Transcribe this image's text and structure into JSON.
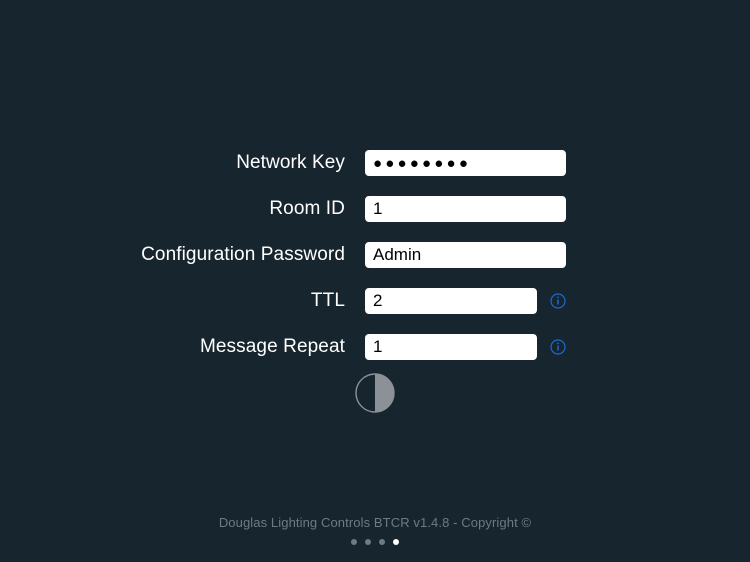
{
  "app": {
    "background_color": "#17252e",
    "accent_color": "#1c69d4",
    "field_background": "#ffffff",
    "label_color": "#ffffff",
    "footer_color": "#6d7b82"
  },
  "form": {
    "fields": [
      {
        "label": "Network Key",
        "value": "●●●●●●●●",
        "placeholder": "",
        "masked": true,
        "has_info": false
      },
      {
        "label": "Room ID",
        "value": "1",
        "placeholder": "",
        "masked": false,
        "has_info": false
      },
      {
        "label": "Configuration Password",
        "value": "Admin",
        "placeholder": "",
        "masked": false,
        "has_info": false
      },
      {
        "label": "TTL",
        "value": "2",
        "placeholder": "",
        "masked": false,
        "has_info": true
      },
      {
        "label": "Message Repeat",
        "value": "1",
        "placeholder": "",
        "masked": false,
        "has_info": true
      }
    ]
  },
  "toggle": {
    "name": "contrast-toggle",
    "icon": "half-filled-circle-icon"
  },
  "footer": {
    "text": "Douglas Lighting Controls BTCR v1.4.8 - Copyright ©"
  },
  "pager": {
    "total": 4,
    "active_index": 3
  }
}
